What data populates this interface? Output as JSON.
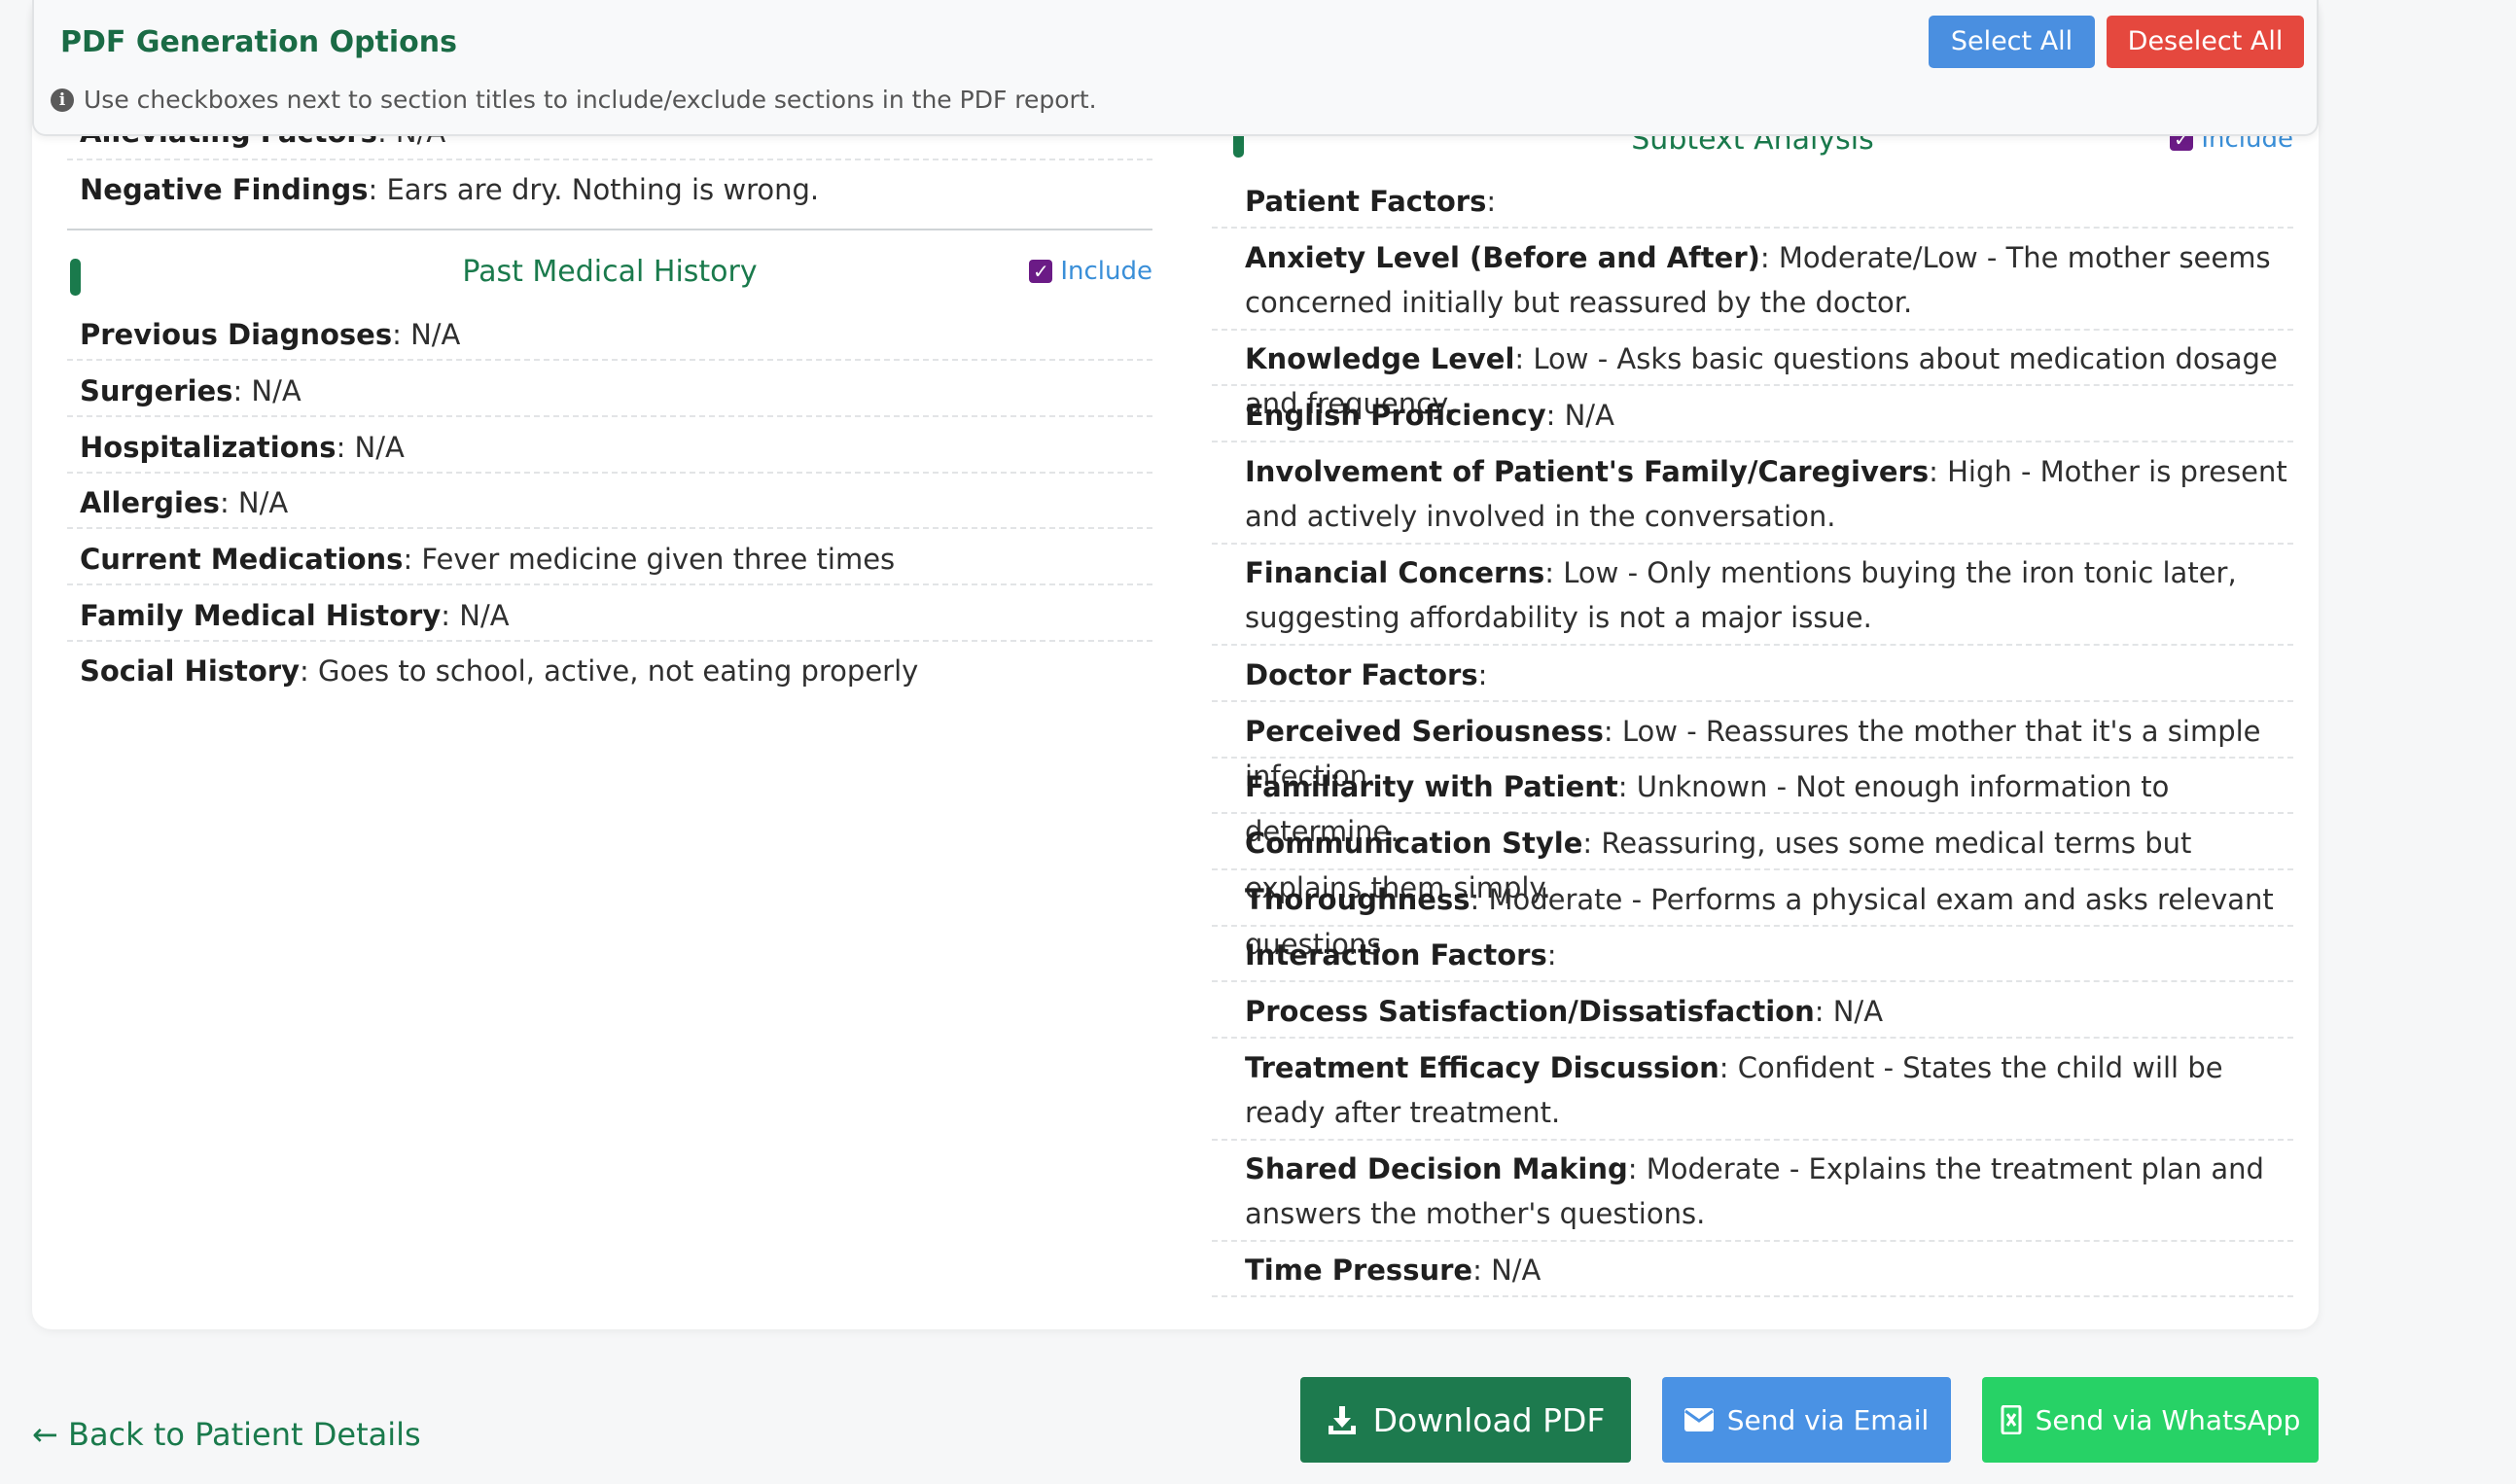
{
  "banner": {
    "title": "PDF Generation Options",
    "info": "Use checkboxes next to section titles to include/exclude sections in the PDF report.",
    "select_all": "Select All",
    "deselect_all": "Deselect All"
  },
  "left": {
    "partial_row": {
      "label": "Alleviating Factors",
      "value": ": N/A"
    },
    "negative_findings": {
      "label": "Negative Findings",
      "value": ": Ears are dry. Nothing is wrong."
    },
    "past_medical": {
      "title": "Past Medical History",
      "include": "Include",
      "rows": [
        {
          "label": "Previous Diagnoses",
          "value": ": N/A"
        },
        {
          "label": "Surgeries",
          "value": ": N/A"
        },
        {
          "label": "Hospitalizations",
          "value": ": N/A"
        },
        {
          "label": "Allergies",
          "value": ": N/A"
        },
        {
          "label": "Current Medications",
          "value": ": Fever medicine given three times"
        },
        {
          "label": "Family Medical History",
          "value": ": N/A"
        },
        {
          "label": "Social History",
          "value": ": Goes to school, active, not eating properly"
        }
      ]
    }
  },
  "right": {
    "subtext": {
      "title": "Subtext Analysis",
      "include": "Include",
      "rows": [
        {
          "label": "Patient Factors",
          "value": ":"
        },
        {
          "label": "Anxiety Level (Before and After)",
          "value": ": Moderate/Low - The mother seems concerned initially but reassured by the doctor."
        },
        {
          "label": "Knowledge Level",
          "value": ": Low - Asks basic questions about medication dosage and frequency."
        },
        {
          "label": "English Proficiency",
          "value": ": N/A"
        },
        {
          "label": "Involvement of Patient's Family/Caregivers",
          "value": ": High - Mother is present and actively involved in the conversation."
        },
        {
          "label": "Financial Concerns",
          "value": ": Low - Only mentions buying the iron tonic later, suggesting affordability is not a major issue."
        },
        {
          "label": "Doctor Factors",
          "value": ":"
        },
        {
          "label": "Perceived Seriousness",
          "value": ": Low - Reassures the mother that it's a simple infection."
        },
        {
          "label": "Familiarity with Patient",
          "value": ": Unknown - Not enough information to determine."
        },
        {
          "label": "Communication Style",
          "value": ": Reassuring, uses some medical terms but explains them simply."
        },
        {
          "label": "Thoroughness",
          "value": ": Moderate - Performs a physical exam and asks relevant questions."
        },
        {
          "label": "Interaction Factors",
          "value": ":"
        },
        {
          "label": "Process Satisfaction/Dissatisfaction",
          "value": ": N/A"
        },
        {
          "label": "Treatment Efficacy Discussion",
          "value": ": Confident - States the child will be ready after treatment."
        },
        {
          "label": "Shared Decision Making",
          "value": ": Moderate - Explains the treatment plan and answers the mother's questions."
        },
        {
          "label": "Time Pressure",
          "value": ": N/A"
        }
      ]
    }
  },
  "footer": {
    "back": "← Back to Patient Details",
    "download_pdf": "Download PDF",
    "send_email": "Send via Email",
    "send_whatsapp": "Send via WhatsApp"
  },
  "colors": {
    "brand_green": "#1a7a4c",
    "select_blue": "#4a8fe0",
    "deselect_red": "#e5483e",
    "whatsapp_green": "#27d266"
  }
}
